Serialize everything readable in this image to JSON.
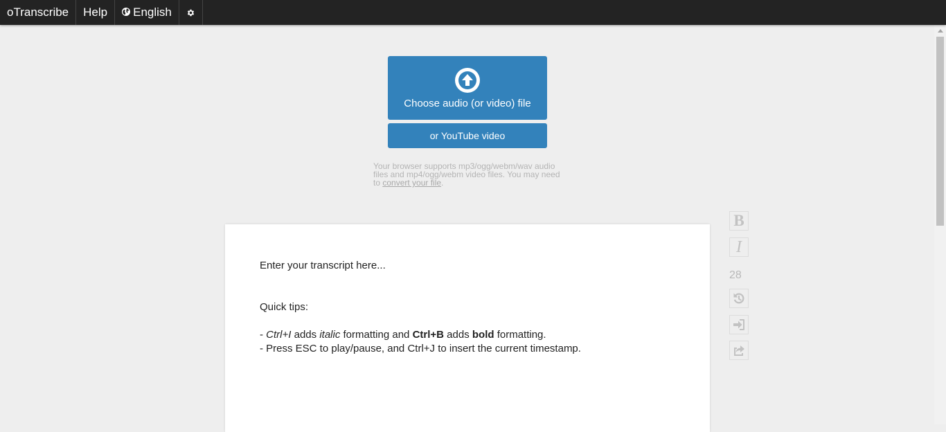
{
  "navbar": {
    "brand": "oTranscribe",
    "help": "Help",
    "language": "English",
    "language_icon": "globe-icon",
    "settings_icon": "gear-icon"
  },
  "upload": {
    "choose_file_label": "Choose audio (or video) file",
    "youtube_label": "or YouTube video",
    "support_text_1": "Your browser supports mp3/ogg/webm/wav audio files and mp4/ogg/webm video files. You may need to ",
    "support_link": "convert your file",
    "support_text_2": ".",
    "accent_color": "#3382bb"
  },
  "editor": {
    "placeholder": "Enter your transcript here...",
    "tips_heading": "Quick tips:",
    "tip1": {
      "prefix": "- ",
      "ctrl_i": "Ctrl+I",
      "adds1": " adds ",
      "italic_word": "italic",
      "middle": " formatting and ",
      "ctrl_b": "Ctrl+B",
      "adds2": " adds ",
      "bold_word": "bold",
      "suffix": " formatting."
    },
    "tip2": "- Press ESC to play/pause, and Ctrl+J to insert the current timestamp."
  },
  "side_controls": {
    "bold_label": "B",
    "italic_label": "I",
    "word_count": "28"
  }
}
